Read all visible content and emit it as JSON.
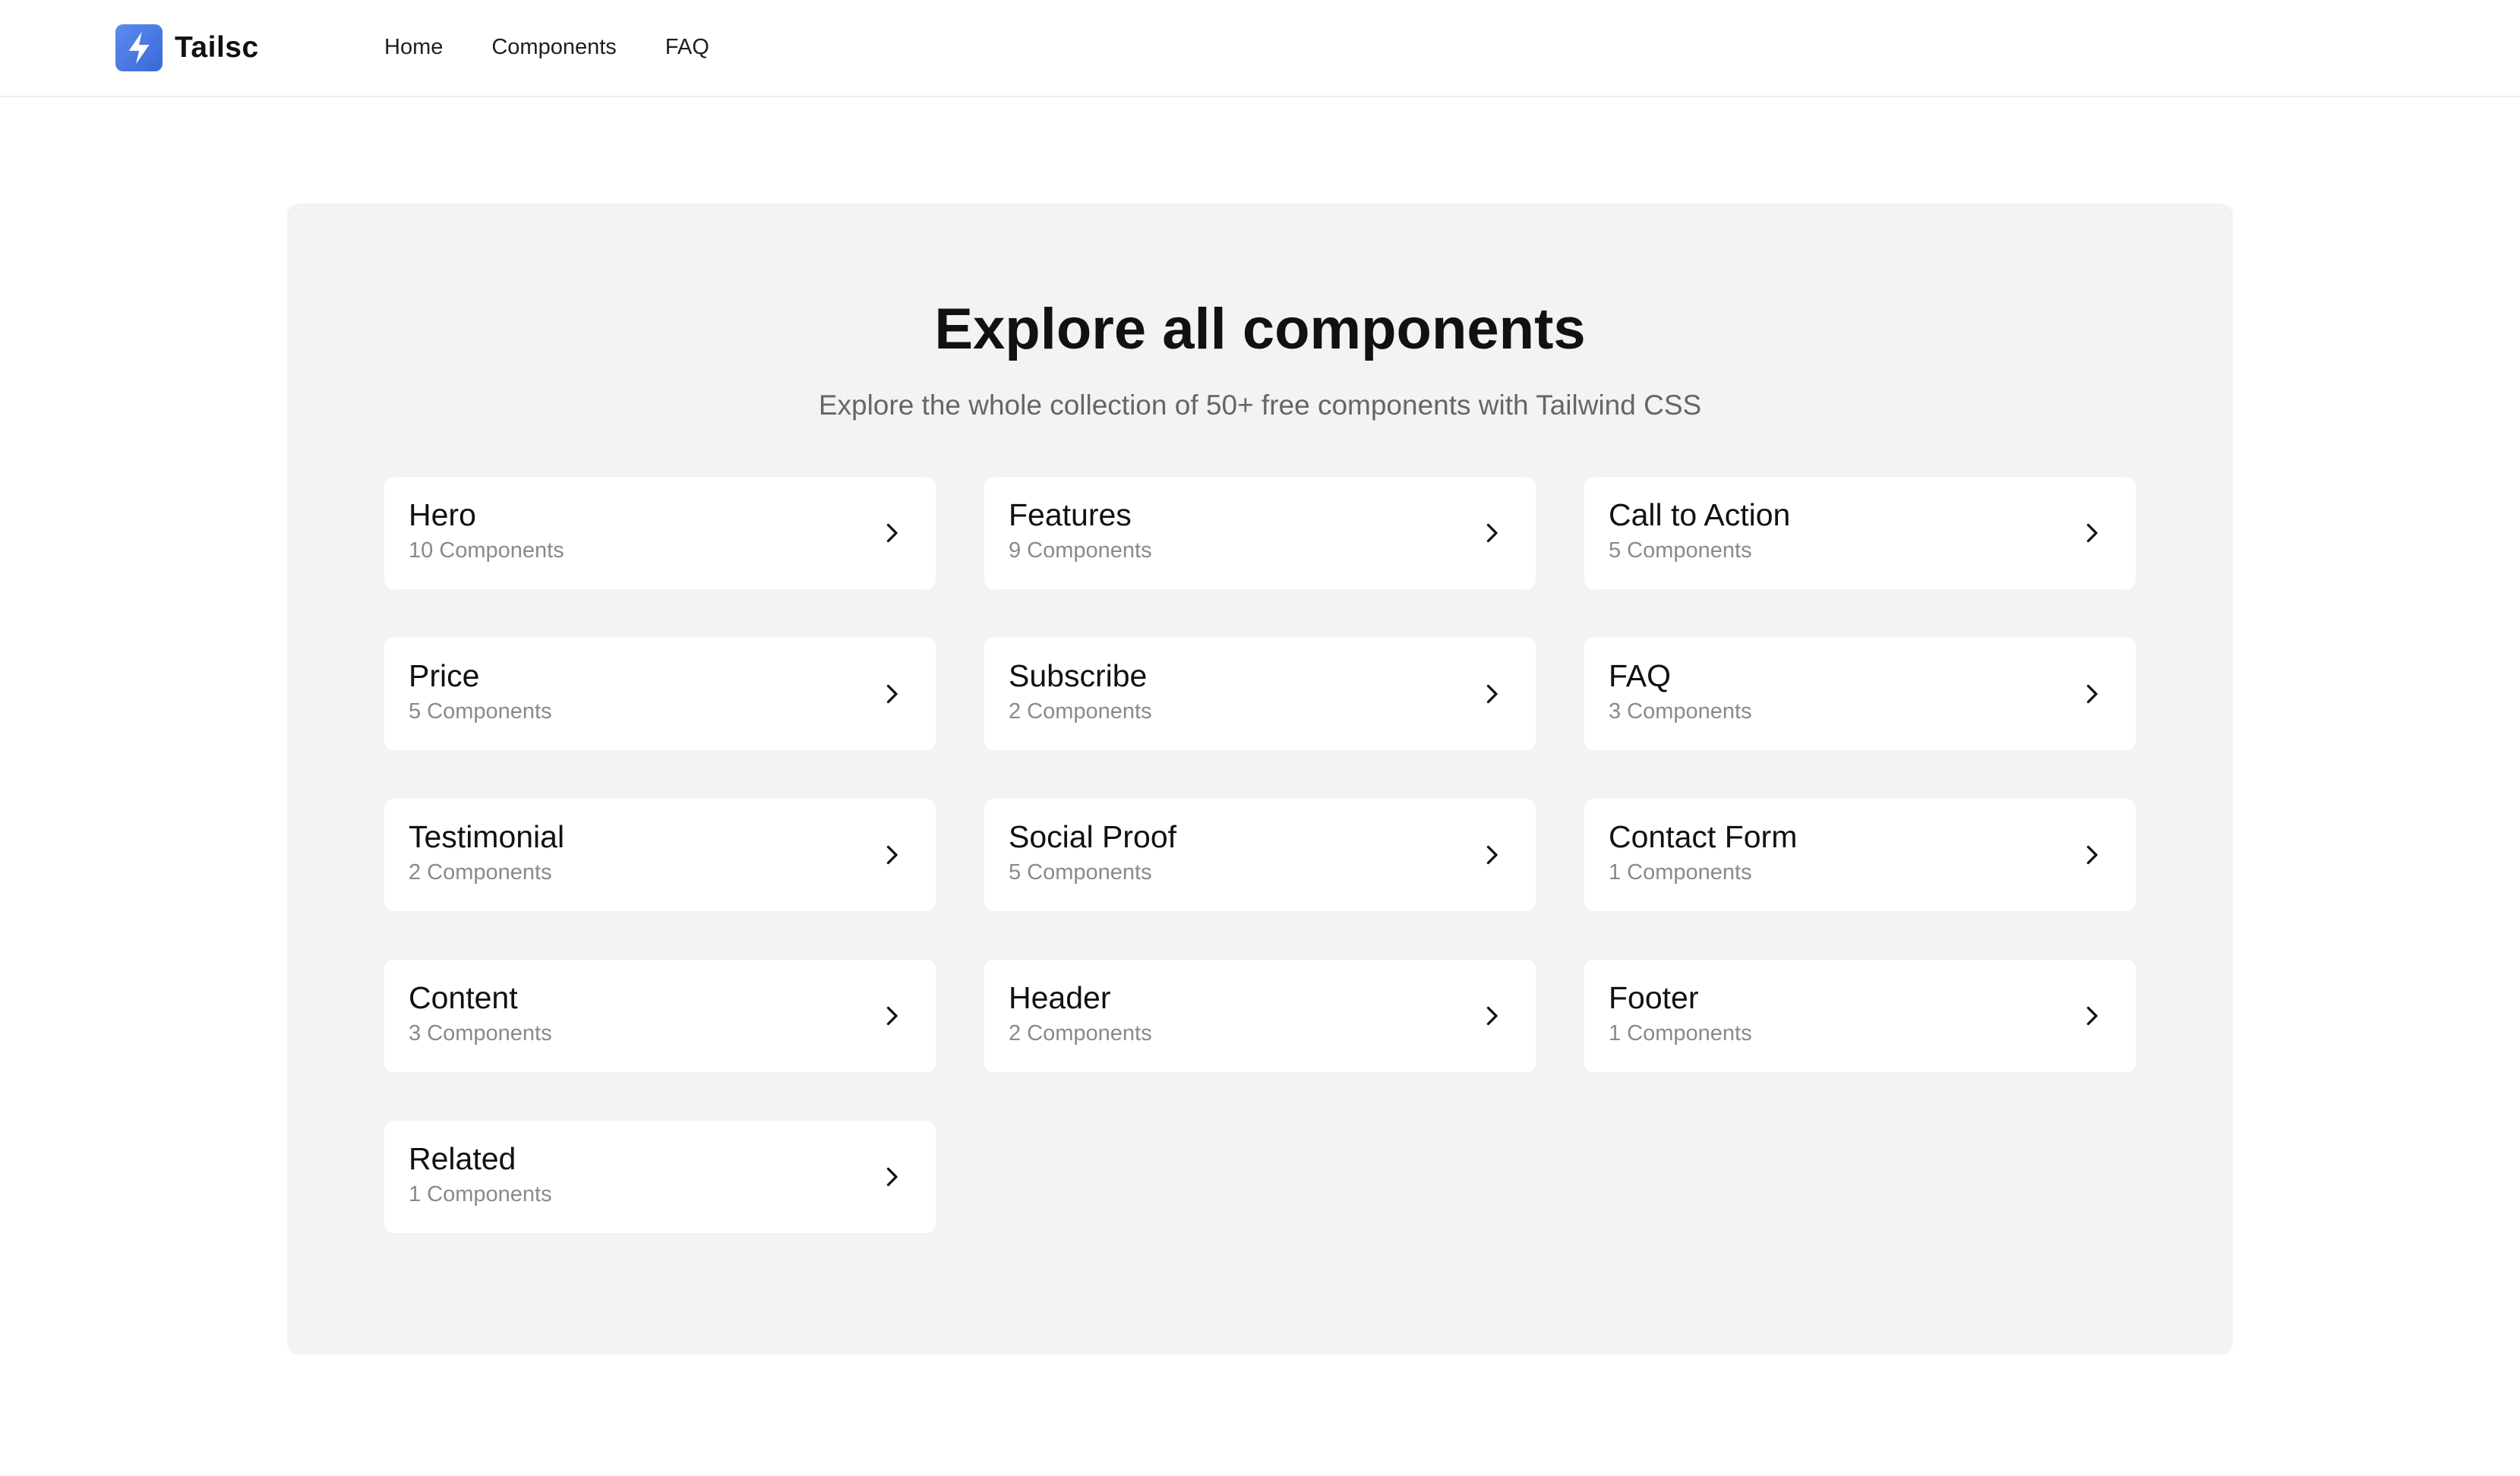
{
  "header": {
    "logo_text": "Tailsc",
    "logo_icon": "lightning-bolt-icon",
    "brand_color": "#4a7be3",
    "nav": [
      {
        "label": "Home"
      },
      {
        "label": "Components"
      },
      {
        "label": "FAQ"
      }
    ]
  },
  "main": {
    "title": "Explore all components",
    "subtitle": "Explore the whole collection of 50+ free components with Tailwind CSS",
    "panel_color": "#f3f3f3",
    "arrow_icon": "chevron-right-icon",
    "categories": [
      {
        "name": "Hero",
        "count": "10 Components"
      },
      {
        "name": "Features",
        "count": "9 Components"
      },
      {
        "name": "Call to Action",
        "count": "5 Components"
      },
      {
        "name": "Price",
        "count": "5 Components"
      },
      {
        "name": "Subscribe",
        "count": "2 Components"
      },
      {
        "name": "FAQ",
        "count": "3 Components"
      },
      {
        "name": "Testimonial",
        "count": "2 Components"
      },
      {
        "name": "Social Proof",
        "count": "5 Components"
      },
      {
        "name": "Contact Form",
        "count": "1 Components"
      },
      {
        "name": "Content",
        "count": "3 Components"
      },
      {
        "name": "Header",
        "count": "2 Components"
      },
      {
        "name": "Footer",
        "count": "1 Components"
      },
      {
        "name": "Related",
        "count": "1 Components"
      }
    ]
  }
}
